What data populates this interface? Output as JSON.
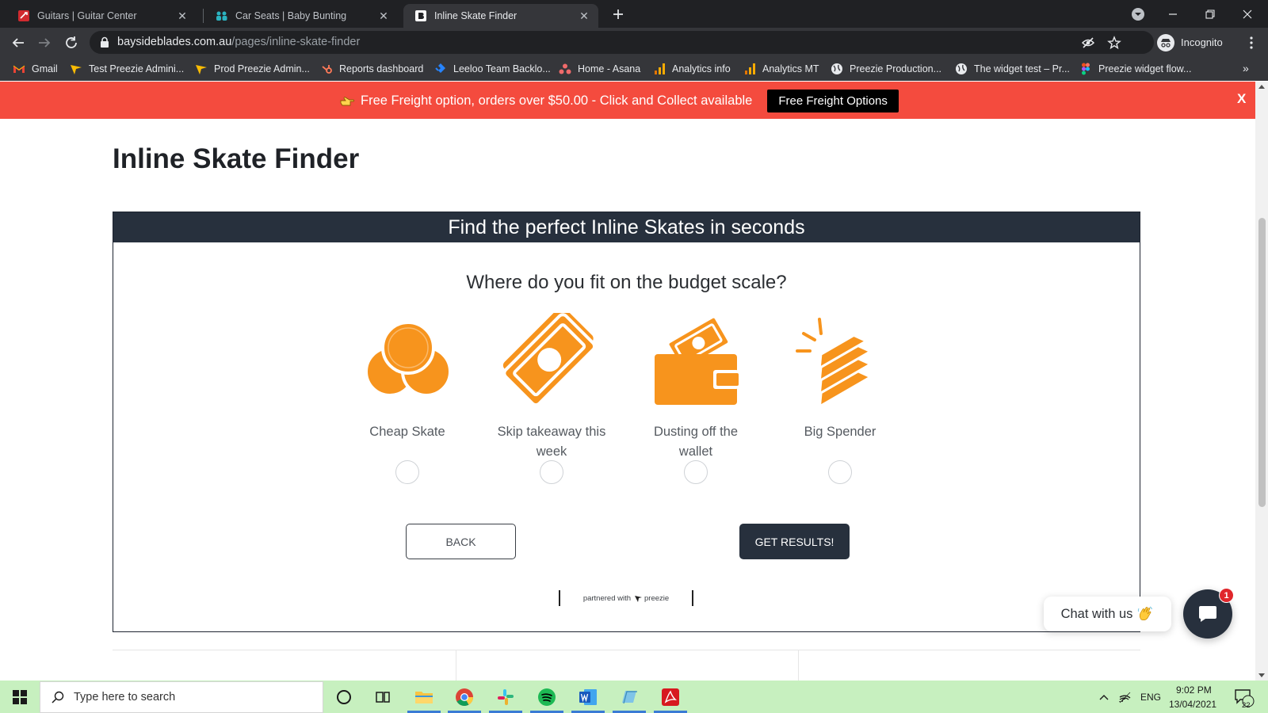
{
  "browser": {
    "tabs": [
      {
        "title": "Guitars | Guitar Center",
        "active": false
      },
      {
        "title": "Car Seats | Baby Bunting",
        "active": false
      },
      {
        "title": "Inline Skate Finder",
        "active": true
      }
    ],
    "url_host": "baysideblades.com.au",
    "url_path": "/pages/inline-skate-finder",
    "incognito_label": "Incognito",
    "bookmarks": [
      "Gmail",
      "Test Preezie Admini...",
      "Prod Preezie Admin...",
      "Reports dashboard",
      "Leeloo Team Backlo...",
      "Home - Asana",
      "Analytics info",
      "Analytics MT",
      "Preezie Production...",
      "The widget test – Pr...",
      "Preezie widget flow..."
    ],
    "bookmarks_more": "»"
  },
  "announcement": {
    "text": "Free Freight option, orders over $50.00 - Click and Collect available",
    "button": "Free Freight Options",
    "close": "X"
  },
  "page": {
    "title": "Inline Skate Finder"
  },
  "finder": {
    "header": "Find the perfect Inline Skates in seconds",
    "question": "Where do you fit on the budget scale?",
    "options": [
      {
        "label": "Cheap Skate",
        "icon": "coins-icon"
      },
      {
        "label": "Skip takeaway this week",
        "icon": "banknote-icon"
      },
      {
        "label": "Dusting off the wallet",
        "icon": "wallet-icon"
      },
      {
        "label": "Big Spender",
        "icon": "gold-bars-icon"
      }
    ],
    "back_label": "BACK",
    "results_label": "GET RESULTS!",
    "partner_text": "partnered with",
    "partner_brand": "preezie",
    "accent_color": "#f7941d",
    "dark_color": "#27303d"
  },
  "chat": {
    "label": "Chat with us",
    "badge": "1"
  },
  "taskbar": {
    "search_placeholder": "Type here to search",
    "language": "ENG",
    "time": "9:02 PM",
    "date": "13/04/2021",
    "notification_count": "22"
  },
  "colors": {
    "announcement_bg": "#f44b3e",
    "taskbar_bg": "#c7f0bf"
  }
}
